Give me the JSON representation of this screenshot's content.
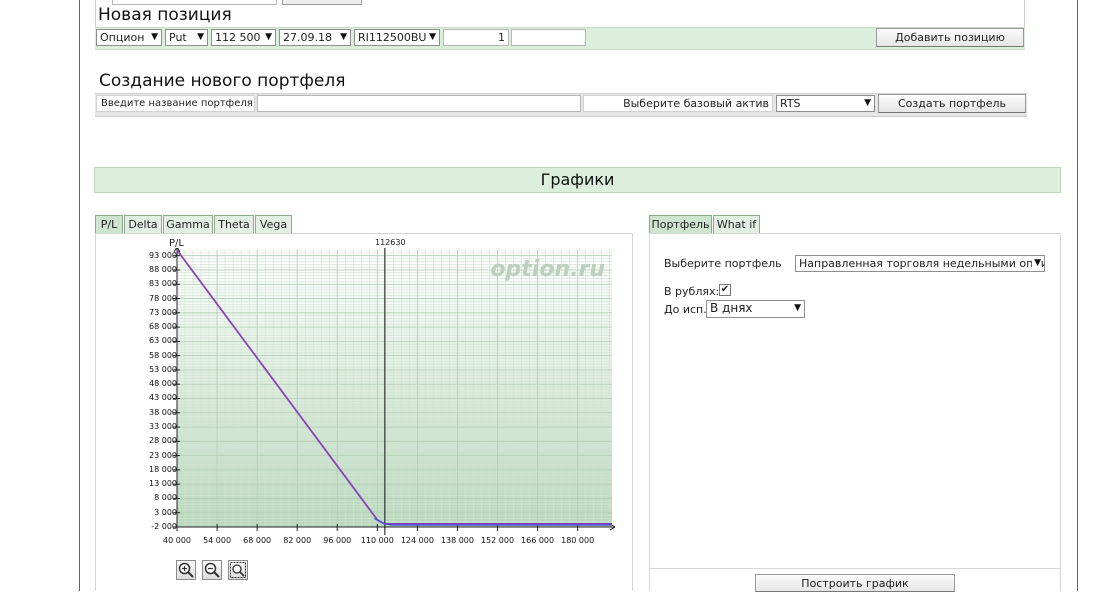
{
  "new_position": {
    "title": "Новая позиция",
    "type_select": "Опцион",
    "option_type_select": "Put",
    "strike_select": "112 500",
    "date_select": "27.09.18",
    "instrument_select": "RI112500BU",
    "quantity_value": "1",
    "price_value": "",
    "add_button": "Добавить позицию"
  },
  "new_portfolio": {
    "title": "Создание нового портфеля",
    "name_label": "Введите название портфеля",
    "name_value": "",
    "base_asset_label": "Выберите базовый актив",
    "base_asset_select": "RTS",
    "create_button": "Создать портфель"
  },
  "graphs_section": {
    "title": "Графики"
  },
  "chart_tabs": [
    "P/L",
    "Delta",
    "Gamma",
    "Theta",
    "Vega"
  ],
  "right_tabs": [
    "Портфель",
    "What if"
  ],
  "portfolio_panel": {
    "select_label": "Выберите портфель",
    "select_value": "Направленная торговля недельными опционами",
    "rubles_label": "В рублях:",
    "rubles_checked": true,
    "expiry_label": "До исп.:",
    "expiry_select": "В днях",
    "build_button": "Построить график"
  },
  "zoom_controls": [
    "zoom-in-icon",
    "zoom-out-icon",
    "zoom-fit-icon"
  ],
  "colors": {
    "section_bg": "#dcefdc",
    "border_green": "#2f8a2f",
    "line_primary": "#8a44b8",
    "line_secondary": "#4747d8",
    "watermark": "#bfcfbf"
  },
  "chart_data": {
    "type": "line",
    "ylabel": "P/L",
    "watermark": "option.ru",
    "marker_label": "112630",
    "marker_x": 112630,
    "xlim": [
      40000,
      192000
    ],
    "ylim": [
      -2000,
      95000
    ],
    "x_ticks": [
      40000,
      54000,
      68000,
      82000,
      96000,
      110000,
      124000,
      138000,
      152000,
      166000,
      180000
    ],
    "x_tick_labels": [
      "40 000",
      "54 000",
      "68 000",
      "82 000",
      "96 000",
      "110 000",
      "124 000",
      "138 000",
      "152 000",
      "166 000",
      "180 000"
    ],
    "y_ticks": [
      93000,
      88000,
      83000,
      78000,
      73000,
      68000,
      63000,
      58000,
      53000,
      48000,
      43000,
      38000,
      33000,
      28000,
      23000,
      18000,
      13000,
      8000,
      3000,
      -2000
    ],
    "y_tick_labels": [
      "93 000",
      "88 000",
      "83 000",
      "78 000",
      "73 000",
      "68 000",
      "63 000",
      "58 000",
      "53 000",
      "48 000",
      "43 000",
      "38 000",
      "33 000",
      "28 000",
      "23 000",
      "18 000",
      "13 000",
      "8 000",
      "3 000",
      "-2 000"
    ],
    "grid": true,
    "series": [
      {
        "values_x": [
          40000,
          110000,
          112500,
          192000
        ],
        "values_y": [
          95000,
          500,
          -900,
          -900
        ]
      },
      {
        "values_x": [
          109000,
          112000,
          115000,
          192000
        ],
        "values_y": [
          1000,
          -700,
          -1300,
          -1300
        ]
      }
    ]
  }
}
